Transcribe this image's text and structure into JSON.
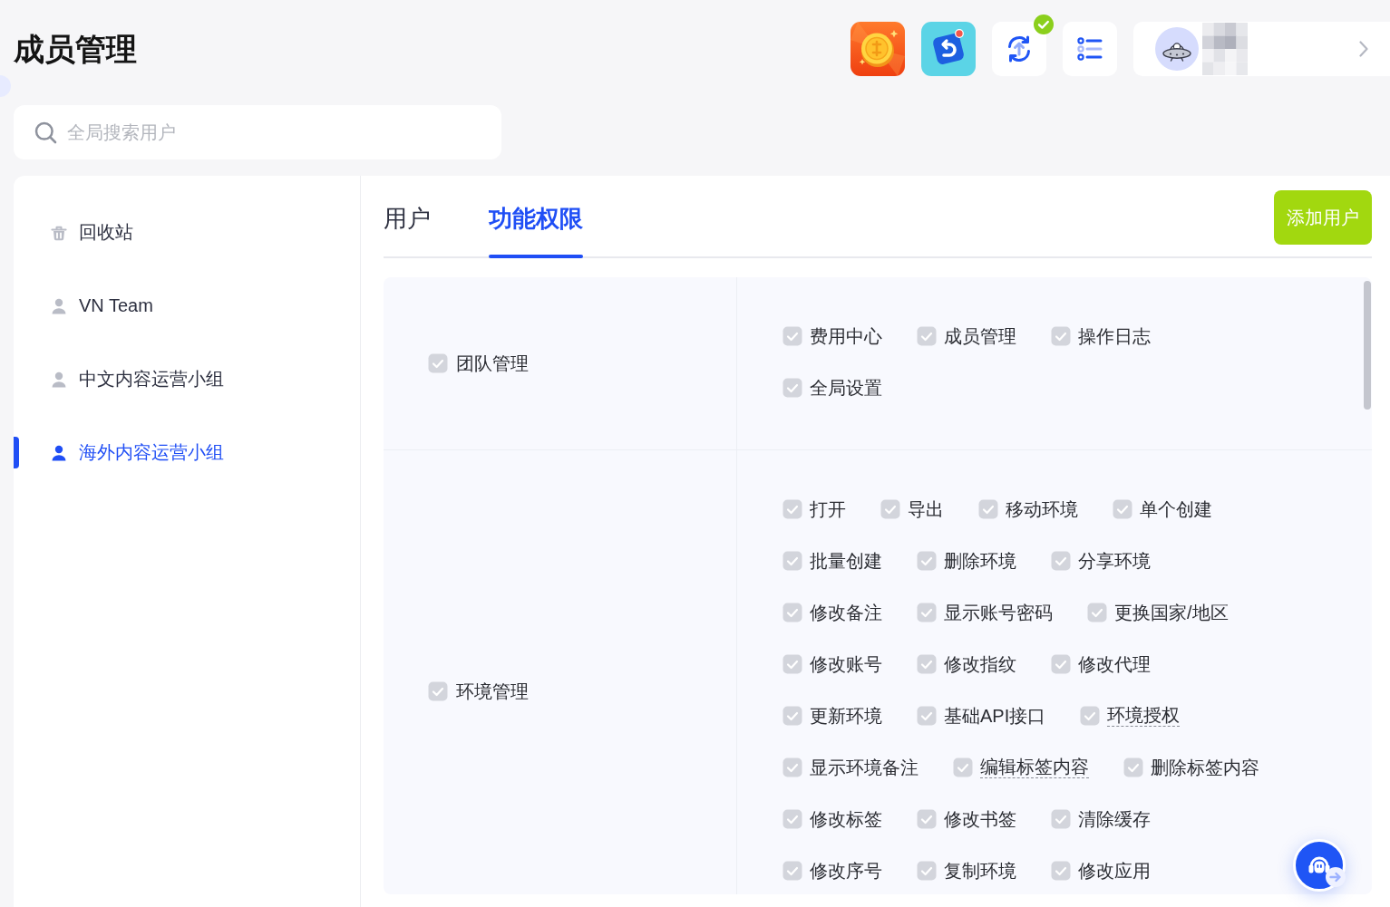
{
  "header": {
    "title": "成员管理"
  },
  "toolbar": {
    "notification_dot": true,
    "upload_done": true
  },
  "search": {
    "placeholder": "全局搜索用户"
  },
  "sidebar": {
    "items": [
      {
        "kind": "trash",
        "label": "回收站",
        "selected": false
      },
      {
        "kind": "group",
        "label": "VN Team",
        "selected": false
      },
      {
        "kind": "group",
        "label": "中文内容运营小组",
        "selected": false
      },
      {
        "kind": "group",
        "label": "海外内容运营小组",
        "selected": true
      }
    ]
  },
  "tabs": [
    {
      "label": "用户",
      "selected": false
    },
    {
      "label": "功能权限",
      "selected": true
    }
  ],
  "add_button": {
    "label": "添加用户"
  },
  "permissions": [
    {
      "label": "团队管理",
      "checked": true,
      "disabled": true,
      "rows": [
        {
          "items": [
            {
              "label": "费用中心",
              "checked": true,
              "disabled": true,
              "hint": false
            },
            {
              "label": "成员管理",
              "checked": true,
              "disabled": true,
              "hint": false
            },
            {
              "label": "操作日志",
              "checked": true,
              "disabled": true,
              "hint": false
            }
          ]
        },
        {
          "items": [
            {
              "label": "全局设置",
              "checked": true,
              "disabled": true,
              "hint": false
            }
          ]
        }
      ]
    },
    {
      "label": "环境管理",
      "checked": true,
      "disabled": true,
      "rows": [
        {
          "items": [
            {
              "label": "打开",
              "checked": true,
              "disabled": true,
              "hint": false
            },
            {
              "label": "导出",
              "checked": true,
              "disabled": true,
              "hint": false
            },
            {
              "label": "移动环境",
              "checked": true,
              "disabled": true,
              "hint": false
            },
            {
              "label": "单个创建",
              "checked": true,
              "disabled": true,
              "hint": false
            }
          ]
        },
        {
          "items": [
            {
              "label": "批量创建",
              "checked": true,
              "disabled": true,
              "hint": false
            },
            {
              "label": "删除环境",
              "checked": true,
              "disabled": true,
              "hint": false
            },
            {
              "label": "分享环境",
              "checked": true,
              "disabled": true,
              "hint": false
            }
          ]
        },
        {
          "items": [
            {
              "label": "修改备注",
              "checked": true,
              "disabled": true,
              "hint": false
            },
            {
              "label": "显示账号密码",
              "checked": true,
              "disabled": true,
              "hint": false
            },
            {
              "label": "更换国家/地区",
              "checked": true,
              "disabled": true,
              "hint": false
            }
          ]
        },
        {
          "items": [
            {
              "label": "修改账号",
              "checked": true,
              "disabled": true,
              "hint": false
            },
            {
              "label": "修改指纹",
              "checked": true,
              "disabled": true,
              "hint": false
            },
            {
              "label": "修改代理",
              "checked": true,
              "disabled": true,
              "hint": false
            }
          ]
        },
        {
          "items": [
            {
              "label": "更新环境",
              "checked": true,
              "disabled": true,
              "hint": false
            },
            {
              "label": "基础API接口",
              "checked": true,
              "disabled": true,
              "hint": false
            },
            {
              "label": "环境授权",
              "checked": true,
              "disabled": true,
              "hint": true
            }
          ]
        },
        {
          "items": [
            {
              "label": "显示环境备注",
              "checked": true,
              "disabled": true,
              "hint": false
            },
            {
              "label": "编辑标签内容",
              "checked": true,
              "disabled": true,
              "hint": true
            },
            {
              "label": "删除标签内容",
              "checked": true,
              "disabled": true,
              "hint": false
            }
          ]
        },
        {
          "items": [
            {
              "label": "修改标签",
              "checked": true,
              "disabled": true,
              "hint": false
            },
            {
              "label": "修改书签",
              "checked": true,
              "disabled": true,
              "hint": false
            },
            {
              "label": "清除缓存",
              "checked": true,
              "disabled": true,
              "hint": false
            }
          ]
        },
        {
          "items": [
            {
              "label": "修改序号",
              "checked": true,
              "disabled": true,
              "hint": false
            },
            {
              "label": "复制环境",
              "checked": true,
              "disabled": true,
              "hint": false
            },
            {
              "label": "修改应用",
              "checked": true,
              "disabled": true,
              "hint": false
            }
          ]
        }
      ]
    }
  ]
}
